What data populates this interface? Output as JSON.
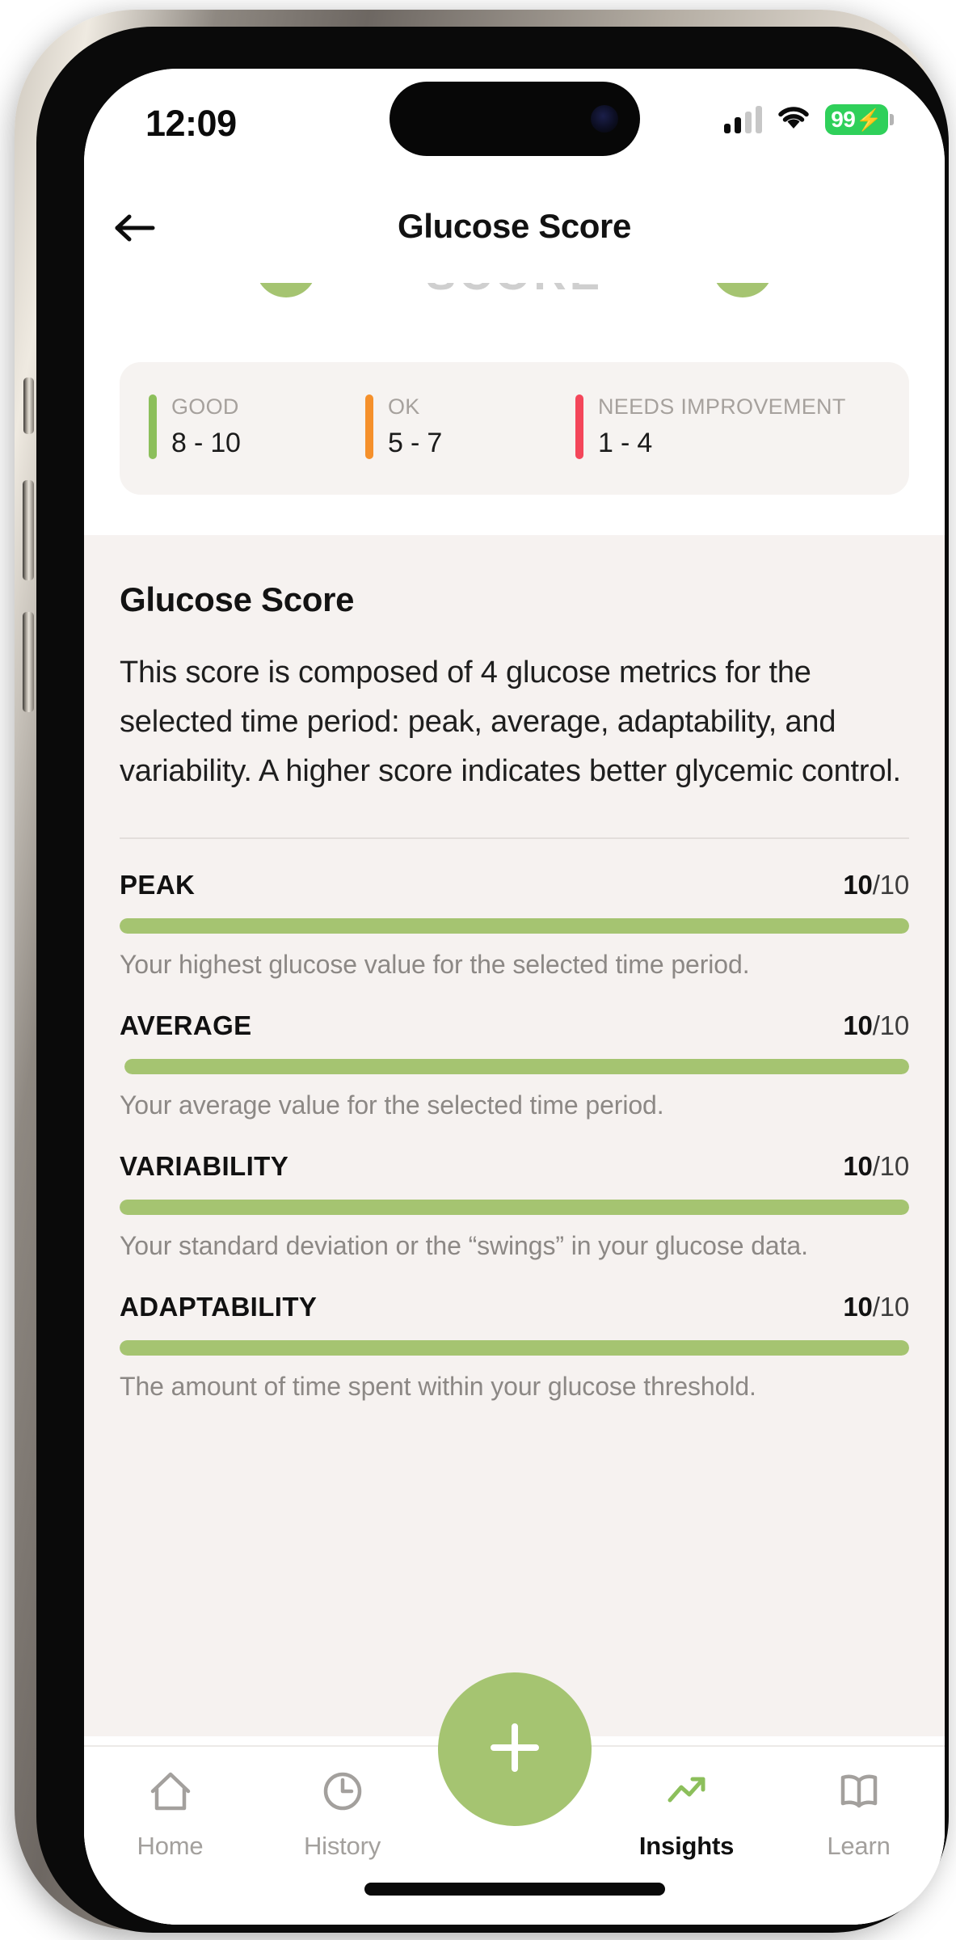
{
  "status_bar": {
    "time": "12:09",
    "battery_level": "99",
    "battery_bolt": "⚡",
    "signal_icon": "cellular-signal-icon",
    "wifi_icon": "wifi-icon",
    "battery_icon": "battery-charging-icon"
  },
  "header": {
    "title": "Glucose Score",
    "back_icon": "back-arrow-icon"
  },
  "hero_clipped": {
    "ghost_text": "SCORE"
  },
  "legend": {
    "items": [
      {
        "label": "GOOD",
        "range": "8 - 10",
        "color": "#8cbf5b"
      },
      {
        "label": "OK",
        "range": "5 - 7",
        "color": "#f5902b"
      },
      {
        "label": "NEEDS IMPROVEMENT",
        "range": "1 - 4",
        "color": "#f4465a"
      }
    ]
  },
  "detail": {
    "title": "Glucose Score",
    "description": "This score is composed of 4 glucose metrics for the selected time period: peak, average, adaptability, and variability. A higher score indicates better glycemic control."
  },
  "metrics": [
    {
      "name": "PEAK",
      "value": "10",
      "denominator": "/10",
      "percent": 100,
      "description": "Your highest glucose value for the selected time period.",
      "color": "#a5c471"
    },
    {
      "name": "AVERAGE",
      "value": "10",
      "denominator": "/10",
      "percent": 100,
      "description": "Your average value for the selected time period.",
      "color": "#a5c471"
    },
    {
      "name": "VARIABILITY",
      "value": "10",
      "denominator": "/10",
      "percent": 100,
      "description": "Your standard deviation or the “swings” in your glucose data.",
      "color": "#a5c471"
    },
    {
      "name": "ADAPTABILITY",
      "value": "10",
      "denominator": "/10",
      "percent": 100,
      "description": "The amount of time spent within your glucose threshold.",
      "color": "#a5c471"
    }
  ],
  "tab_bar": {
    "items": [
      {
        "label": "Home",
        "icon": "home-icon",
        "active": false
      },
      {
        "label": "History",
        "icon": "clock-icon",
        "active": false
      },
      {
        "label": "Insights",
        "icon": "trending-up-icon",
        "active": true
      },
      {
        "label": "Learn",
        "icon": "book-icon",
        "active": false
      }
    ],
    "fab_icon": "plus-icon",
    "accent_color": "#a5c471"
  }
}
